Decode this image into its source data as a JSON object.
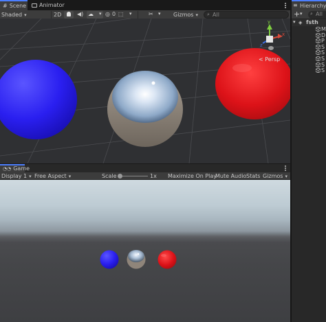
{
  "scene_panel": {
    "tabs": [
      {
        "label": "Scene",
        "icon": "hashtag-icon",
        "active": true
      },
      {
        "label": "Animator",
        "icon": "animator-icon",
        "active": false
      }
    ],
    "toolbar": {
      "draw_mode": "Shaded",
      "mode_2d": "2D",
      "hidden_count": "0",
      "gizmos_label": "Gizmos",
      "search_placeholder": "All"
    },
    "orientation_gizmo": {
      "axes": [
        "y",
        "x",
        "z"
      ],
      "projection_label": "< Persp"
    },
    "objects": [
      {
        "name": "blue-sphere",
        "color": "#2b20ee"
      },
      {
        "name": "reflective-sphere",
        "color": "#bfc6cf"
      },
      {
        "name": "red-sphere",
        "color": "#d8141c"
      }
    ]
  },
  "game_panel": {
    "tab": {
      "label": "Game",
      "icon": "gamepad-icon"
    },
    "toolbar": {
      "display": "Display 1",
      "aspect": "Free Aspect",
      "scale_label": "Scale",
      "scale_value": "1x",
      "scale_fraction": 0.0,
      "maximize": "Maximize On Play",
      "mute": "Mute Audio",
      "stats": "Stats",
      "gizmos": "Gizmos"
    },
    "objects": [
      {
        "name": "blue-sphere",
        "color": "#2b20ee"
      },
      {
        "name": "reflective-sphere",
        "color": "#bfc6cf"
      },
      {
        "name": "red-sphere",
        "color": "#d8141c"
      }
    ]
  },
  "hierarchy": {
    "tab_label": "Hierarchy",
    "add_label": "+",
    "search_placeholder": "All",
    "scene_name": "fsth",
    "items": [
      "M",
      "D",
      "P",
      "S",
      "S",
      "S",
      "S",
      "S"
    ]
  },
  "colors": {
    "accent": "#4c7fff",
    "panel_bg": "#3c3c3c",
    "window_bg": "#191919",
    "scene_bg": "#2f3033"
  }
}
